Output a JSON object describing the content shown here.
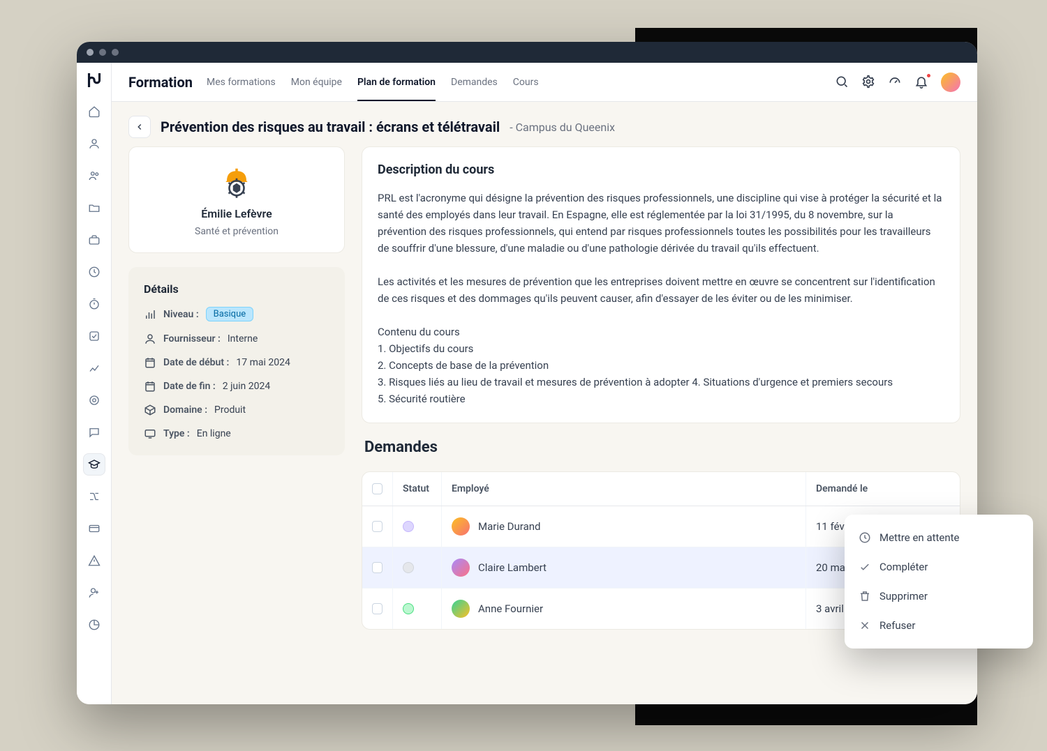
{
  "module": {
    "title": "Formation"
  },
  "tabs": [
    {
      "label": "Mes formations",
      "active": false
    },
    {
      "label": "Mon équipe",
      "active": false
    },
    {
      "label": "Plan de formation",
      "active": true
    },
    {
      "label": "Demandes",
      "active": false
    },
    {
      "label": "Cours",
      "active": false
    }
  ],
  "page": {
    "title": "Prévention des risques au travail : écrans et télétravail",
    "subtitle": "- Campus du Queenix"
  },
  "author": {
    "name": "Émilie Lefèvre",
    "category": "Santé et prévention"
  },
  "details": {
    "heading": "Détails",
    "level_label": "Niveau :",
    "level_value": "Basique",
    "provider_label": "Fournisseur :",
    "provider_value": "Interne",
    "start_label": "Date de début :",
    "start_value": "17 mai 2024",
    "end_label": "Date de fin :",
    "end_value": "2 juin 2024",
    "domain_label": "Domaine :",
    "domain_value": "Produit",
    "type_label": "Type :",
    "type_value": "En ligne"
  },
  "description": {
    "heading": "Description du cours",
    "body": "PRL est l'acronyme qui désigne la prévention des risques professionnels, une discipline qui vise à protéger la sécurité et la santé des employés dans leur travail. En Espagne, elle est réglementée par la loi 31/1995, du 8 novembre, sur la prévention des risques professionnels, qui entend par risques professionnels toutes les possibilités pour les travailleurs de souffrir d'une blessure, d'une maladie ou d'une pathologie dérivée du travail qu'ils effectuent.\n\nLes activités et les mesures de prévention que les entreprises doivent mettre en œuvre se concentrent sur l'identification de ces risques et des dommages qu'ils peuvent causer, afin d'essayer de les éviter ou de les minimiser.\n\nContenu du cours\n1. Objectifs du cours\n2. Concepts de base de la prévention\n3. Risques liés au lieu de travail et mesures de prévention à adopter 4. Situations d'urgence et premiers secours\n5. Sécurité routière"
  },
  "requests": {
    "heading": "Demandes",
    "columns": {
      "status": "Statut",
      "employee": "Employé",
      "requested": "Demandé le"
    },
    "rows": [
      {
        "status": "purple",
        "name": "Marie Durand",
        "date": "11 février 2024",
        "highlight": false
      },
      {
        "status": "grey",
        "name": "Claire Lambert",
        "date": "20 mai 2024",
        "highlight": true
      },
      {
        "status": "green",
        "name": "Anne Fournier",
        "date": "3 avril 2024",
        "highlight": false
      }
    ]
  },
  "menu": {
    "hold": "Mettre en attente",
    "complete": "Compléter",
    "delete": "Supprimer",
    "refuse": "Refuser"
  }
}
